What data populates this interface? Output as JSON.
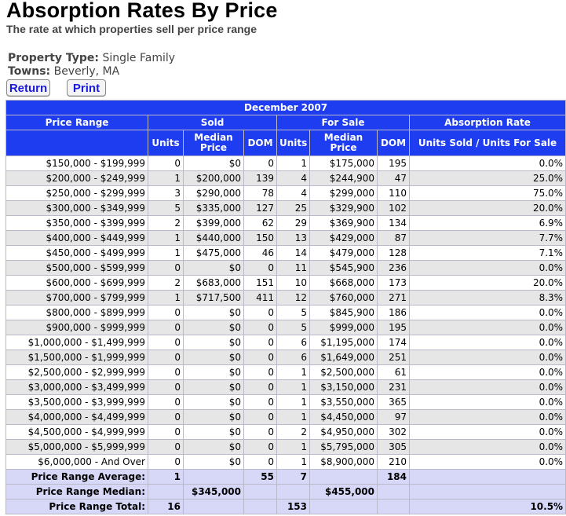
{
  "page": {
    "title": "Absorption Rates By Price",
    "subtitle": "The rate at which properties sell per price range"
  },
  "meta": {
    "property_type_label": "Property Type:",
    "property_type_value": "Single Family",
    "towns_label": "Towns:",
    "towns_value": "Beverly, MA"
  },
  "buttons": {
    "return_label": "Return",
    "print_label": "Print"
  },
  "table": {
    "period": "December 2007",
    "groups": {
      "price_range": "Price Range",
      "sold": "Sold",
      "for_sale": "For Sale",
      "absorption_rate": "Absorption Rate"
    },
    "columns": {
      "sold_units": "Units",
      "sold_median": "Median Price",
      "sold_dom": "DOM",
      "fs_units": "Units",
      "fs_median": "Median Price",
      "fs_dom": "DOM",
      "rate": "Units Sold / Units For Sale"
    },
    "rows": [
      [
        "$150,000 - $199,999",
        "0",
        "$0",
        "0",
        "1",
        "$175,000",
        "195",
        "0.0%"
      ],
      [
        "$200,000 - $249,999",
        "1",
        "$200,000",
        "139",
        "4",
        "$244,900",
        "47",
        "25.0%"
      ],
      [
        "$250,000 - $299,999",
        "3",
        "$290,000",
        "78",
        "4",
        "$299,000",
        "110",
        "75.0%"
      ],
      [
        "$300,000 - $349,999",
        "5",
        "$335,000",
        "127",
        "25",
        "$329,900",
        "102",
        "20.0%"
      ],
      [
        "$350,000 - $399,999",
        "2",
        "$399,000",
        "62",
        "29",
        "$369,900",
        "134",
        "6.9%"
      ],
      [
        "$400,000 - $449,999",
        "1",
        "$440,000",
        "150",
        "13",
        "$429,000",
        "87",
        "7.7%"
      ],
      [
        "$450,000 - $499,999",
        "1",
        "$475,000",
        "46",
        "14",
        "$479,000",
        "128",
        "7.1%"
      ],
      [
        "$500,000 - $599,999",
        "0",
        "$0",
        "0",
        "11",
        "$545,900",
        "236",
        "0.0%"
      ],
      [
        "$600,000 - $699,999",
        "2",
        "$683,000",
        "151",
        "10",
        "$668,000",
        "173",
        "20.0%"
      ],
      [
        "$700,000 - $799,999",
        "1",
        "$717,500",
        "411",
        "12",
        "$760,000",
        "271",
        "8.3%"
      ],
      [
        "$800,000 - $899,999",
        "0",
        "$0",
        "0",
        "5",
        "$845,900",
        "186",
        "0.0%"
      ],
      [
        "$900,000 - $999,999",
        "0",
        "$0",
        "0",
        "5",
        "$999,000",
        "195",
        "0.0%"
      ],
      [
        "$1,000,000 - $1,499,999",
        "0",
        "$0",
        "0",
        "6",
        "$1,195,000",
        "174",
        "0.0%"
      ],
      [
        "$1,500,000 - $1,999,999",
        "0",
        "$0",
        "0",
        "6",
        "$1,649,000",
        "251",
        "0.0%"
      ],
      [
        "$2,500,000 - $2,999,999",
        "0",
        "$0",
        "0",
        "1",
        "$2,500,000",
        "61",
        "0.0%"
      ],
      [
        "$3,000,000 - $3,499,999",
        "0",
        "$0",
        "0",
        "1",
        "$3,150,000",
        "231",
        "0.0%"
      ],
      [
        "$3,500,000 - $3,999,999",
        "0",
        "$0",
        "0",
        "1",
        "$3,550,000",
        "365",
        "0.0%"
      ],
      [
        "$4,000,000 - $4,499,999",
        "0",
        "$0",
        "0",
        "1",
        "$4,450,000",
        "97",
        "0.0%"
      ],
      [
        "$4,500,000 - $4,999,999",
        "0",
        "$0",
        "0",
        "2",
        "$4,950,000",
        "302",
        "0.0%"
      ],
      [
        "$5,000,000 - $5,999,999",
        "0",
        "$0",
        "0",
        "1",
        "$5,795,000",
        "305",
        "0.0%"
      ],
      [
        "$6,000,000 - And Over",
        "0",
        "$0",
        "0",
        "1",
        "$8,900,000",
        "210",
        "0.0%"
      ]
    ],
    "summary": [
      [
        "Price Range Average:",
        "1",
        "",
        "55",
        "7",
        "",
        "184",
        ""
      ],
      [
        "Price Range Median:",
        "",
        "$345,000",
        "",
        "",
        "$455,000",
        "",
        ""
      ],
      [
        "Price Range Total:",
        "16",
        "",
        "",
        "153",
        "",
        "",
        "10.5%"
      ]
    ]
  },
  "colors": {
    "header_bg": "#1e3cf0",
    "summary_bg": "#d7d7f8",
    "row_alt_bg": "#e6e6e6",
    "button_text": "#1a1adc"
  }
}
